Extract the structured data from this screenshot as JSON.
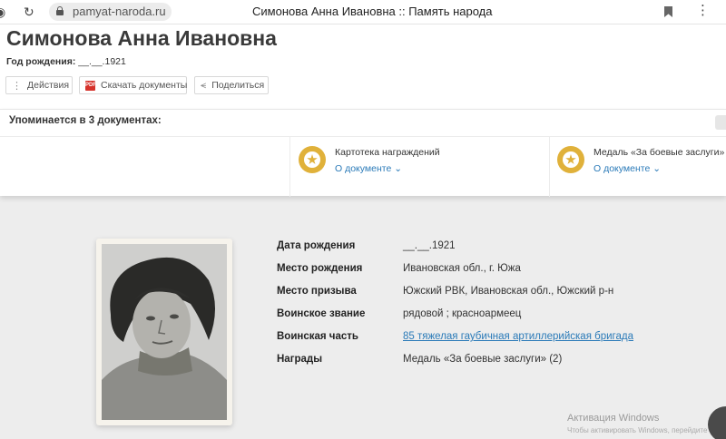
{
  "browser": {
    "url": "pamyat-naroda.ru",
    "tab_title": "Симонова Анна Ивановна :: Память народа"
  },
  "header": {
    "name": "Симонова Анна Ивановна",
    "birth_label": "Год рождения:",
    "birth_value": "__.__.1921",
    "buttons": {
      "actions": "Действия",
      "download": "Скачать документы",
      "share": "Поделиться"
    }
  },
  "mentions": {
    "title": "Упоминается в 3 документах:",
    "documents": [
      {
        "title": "Картотека награждений",
        "link": "О документе ⌄",
        "icon": "medal-icon"
      },
      {
        "title": "Медаль «За боевые заслуги»",
        "link": "О документе ⌄",
        "icon": "medal-icon"
      }
    ]
  },
  "details": [
    {
      "label": "Дата рождения",
      "value": "__.__.1921"
    },
    {
      "label": "Место рождения",
      "value": "Ивановская обл., г. Южа"
    },
    {
      "label": "Место призыва",
      "value": "Южский РВК, Ивановская обл., Южский р-н"
    },
    {
      "label": "Воинское звание",
      "value": "рядовой ; красноармеец"
    },
    {
      "label": "Воинская часть",
      "value": "85 тяжелая гаубичная артиллерийская бригада"
    },
    {
      "label": "Награды",
      "value": "Медаль «За боевые заслуги» (2)"
    }
  ],
  "watermark": {
    "line1": "Активация Windows",
    "line2": "Чтобы активировать Windows, перейдите в р"
  },
  "colors": {
    "accent_link": "#2a7ab8",
    "medal_gold": "#e0b13a",
    "page_bg": "#ededed"
  }
}
